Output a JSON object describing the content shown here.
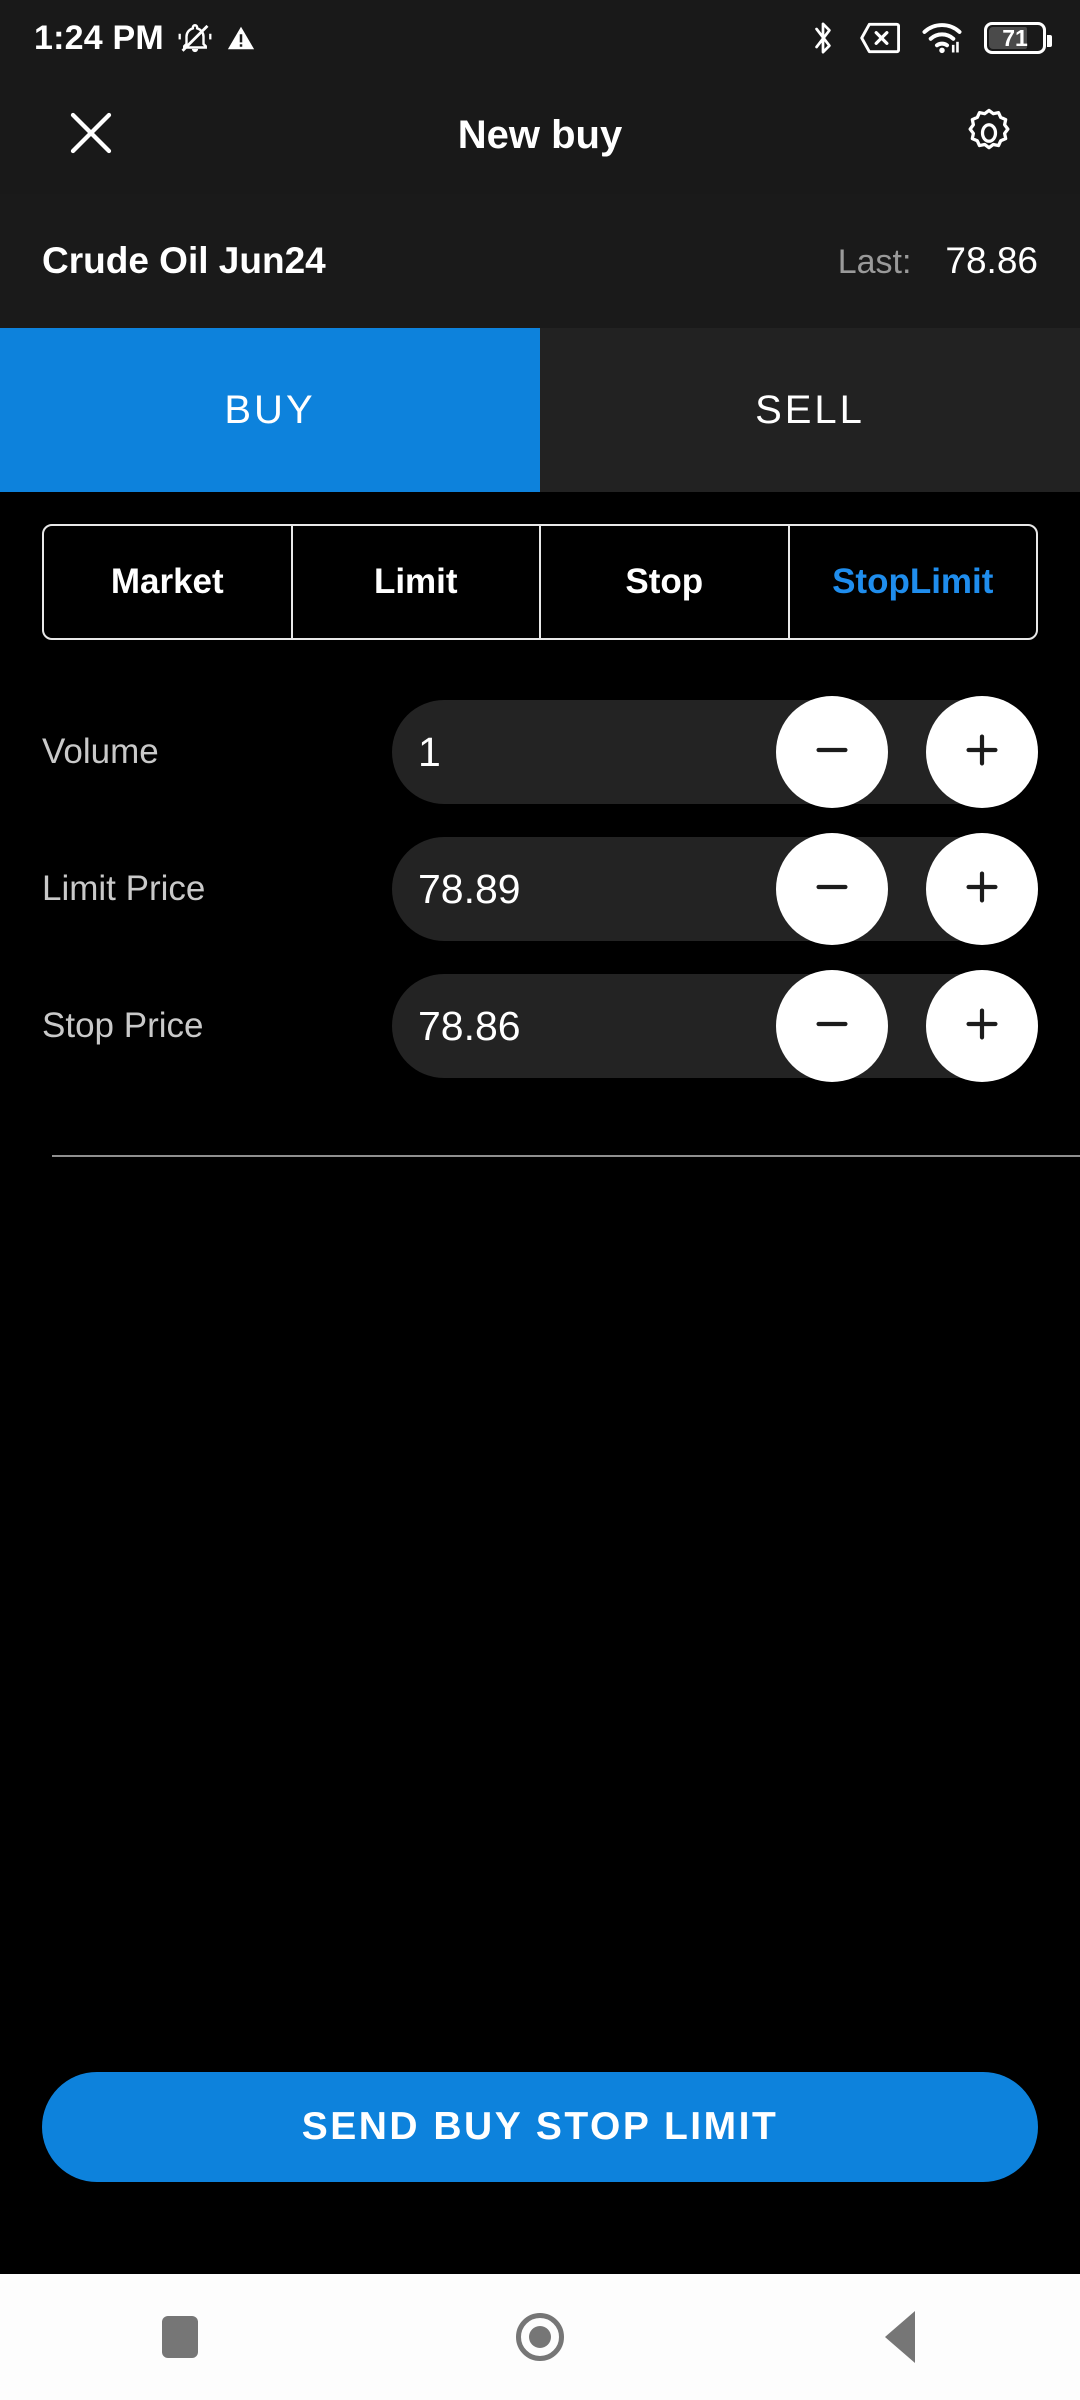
{
  "status_bar": {
    "time": "1:24 PM",
    "battery_level": "71",
    "icons": [
      "bell-mute-icon",
      "warning-triangle-icon",
      "bluetooth-icon",
      "sim-card-off-icon",
      "wifi-icon",
      "battery-icon"
    ]
  },
  "header": {
    "title": "New buy",
    "close_icon": "close-icon",
    "settings_icon": "gear-icon"
  },
  "instrument": {
    "name": "Crude Oil Jun24",
    "last_label": "Last:",
    "last_value": "78.86"
  },
  "side_tabs": {
    "buy": "BUY",
    "sell": "SELL",
    "active": "BUY",
    "active_color": "#0d82dc",
    "inactive_color": "#222222"
  },
  "order_types": {
    "items": [
      {
        "label": "Market",
        "selected": false
      },
      {
        "label": "Limit",
        "selected": false
      },
      {
        "label": "Stop",
        "selected": false
      },
      {
        "label": "StopLimit",
        "selected": true
      }
    ],
    "selected_color": "#1f8ded"
  },
  "form": {
    "rows": [
      {
        "label": "Volume",
        "value": "1"
      },
      {
        "label": "Limit Price",
        "value": "78.89"
      },
      {
        "label": "Stop Price",
        "value": "78.86"
      }
    ],
    "decrement_icon": "minus-icon",
    "increment_icon": "plus-icon"
  },
  "send_button": {
    "label": "SEND BUY STOP LIMIT",
    "color": "#0d82dc"
  },
  "nav_bar": {
    "recents_icon": "square-recents-icon",
    "home_icon": "circle-home-icon",
    "back_icon": "triangle-back-icon"
  }
}
